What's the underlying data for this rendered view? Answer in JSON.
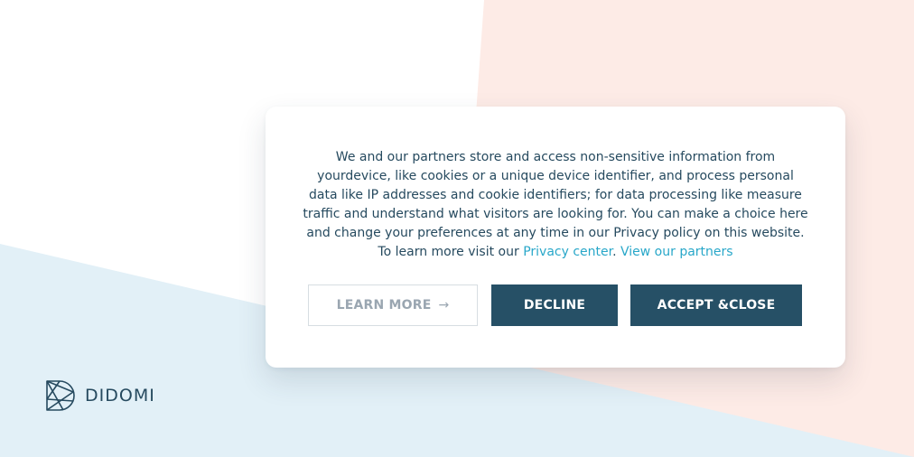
{
  "consent": {
    "text_main": "We and our partners store and access non-sensitive information from yourdevice, like cookies or a unique device identifier, and process personal data like IP addresses and cookie identifiers; for data processing like measure traffic and understand what visitors are looking for. You can make a choice here and change your preferences at any time in our Privacy policy on this website. To learn more visit our ",
    "privacy_center_link": "Privacy center",
    "separator": ". ",
    "partners_link": "View our partners",
    "learn_more_label": "LEARN MORE",
    "learn_more_arrow": "→",
    "decline_label": "DECLINE",
    "accept_label": "ACCEPT &CLOSE"
  },
  "brand": {
    "name": "DIDOMI",
    "logo_icon": "didomi-logo-icon"
  },
  "colors": {
    "primary_dark": "#265066",
    "link": "#28a7c9",
    "bg_pink": "#fdebe6",
    "bg_blue": "#e2f0f7"
  }
}
